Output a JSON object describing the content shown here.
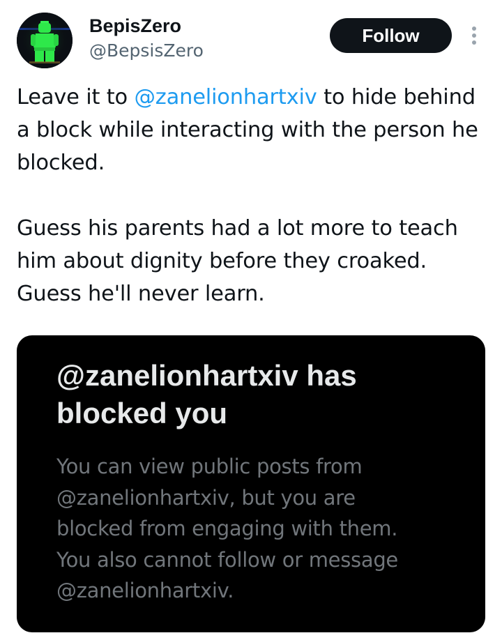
{
  "author": {
    "name": "BepisZero",
    "handle": "@BepsisZero",
    "avatar_icon": "lego-minifigure-avatar-icon"
  },
  "actions": {
    "follow_label": "Follow",
    "more_icon": "more-vertical-icon"
  },
  "tweet": {
    "paragraph1": {
      "prefix": "Leave it to ",
      "mention": "@zanelionhartxiv",
      "suffix": " to hide behind a block while interacting with the person he blocked."
    },
    "paragraph2": "Guess his parents had a lot more to teach him about dignity before they croaked. Guess he'll never learn."
  },
  "screenshot_card": {
    "title_lines": [
      "@zanelionhartxiv has",
      "blocked you"
    ],
    "body_lines": [
      "You can view public posts from",
      "@zanelionhartxiv, but you are",
      "blocked from engaging with them.",
      "You also cannot follow or message",
      "@zanelionhartxiv."
    ]
  },
  "colors": {
    "link": "#1d9bf0",
    "text": "#0f1419",
    "handle": "#536471",
    "card_bg": "#000000",
    "card_title": "#e7e9ea",
    "card_body": "#71767b",
    "avatar_figure": "#2ee84a"
  }
}
